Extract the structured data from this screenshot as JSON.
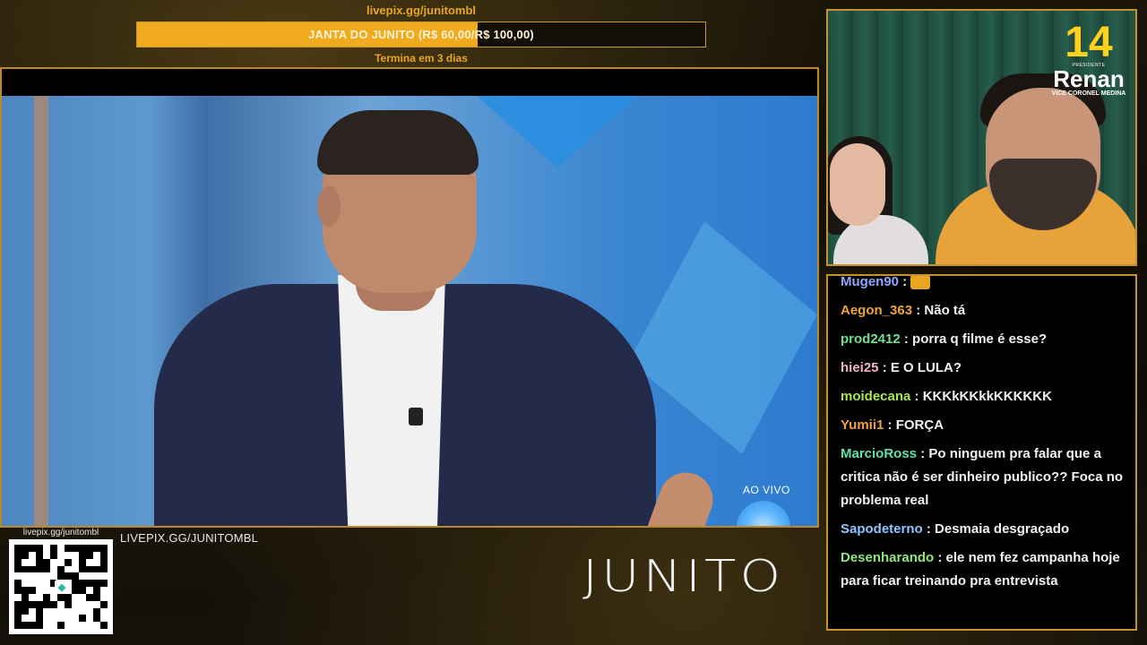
{
  "pix": {
    "link_top": "livepix.gg/junitombl",
    "goal_label": "JANTA DO JUNITO (R$ 60,00/R$ 100,00)",
    "goal_fraction": 0.6,
    "goal_remaining": "Termina em 3 dias"
  },
  "video": {
    "live_label": "AO VIVO"
  },
  "bottom": {
    "qr_caption": "livepix.gg/junitombl",
    "livepix_text": "LIVEPIX.GG/JUNITOMBL",
    "channel_logo": "JUNITO"
  },
  "webcam": {
    "badge_number": "14",
    "badge_presidente": "PRESIDENTE",
    "badge_name": "Renan",
    "badge_vice": "VICE CORONEL MEDINA"
  },
  "chat": {
    "messages": [
      {
        "user": "Mugen90",
        "color": "#8ea6ff",
        "text": "",
        "emote": "crown-emote"
      },
      {
        "user": "Aegon_363",
        "color": "#f0a23a",
        "text": "Não tá"
      },
      {
        "user": "prod2412",
        "color": "#6fe08c",
        "text": "porra q filme é esse?"
      },
      {
        "user": "hiei25",
        "color": "#f2b3c4",
        "text": "E O LULA?"
      },
      {
        "user": "moidecana",
        "color": "#a8ea4b",
        "text": "KKKkKKkkKKKKKK"
      },
      {
        "user": "Yumii1",
        "color": "#f0a23a",
        "text": "FORÇA"
      },
      {
        "user": "MarcioRoss",
        "color": "#5fe3a6",
        "text": "Po ninguem pra falar que a critica não é ser dinheiro publico?? Foca no problema real"
      },
      {
        "user": "Sapodeterno",
        "color": "#8ec6ff",
        "text": "Desmaia desgraçado"
      },
      {
        "user": "Desenharando",
        "color": "#8fe87a",
        "text": "ele nem fez campanha hoje para ficar treinando pra entrevista"
      }
    ]
  }
}
